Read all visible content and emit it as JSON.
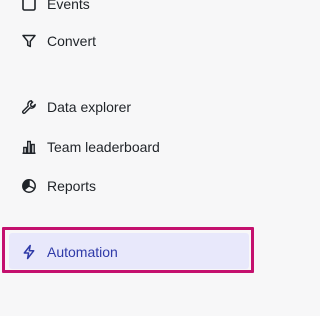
{
  "sidebar": {
    "items": [
      {
        "label": "Events",
        "icon": "square-icon"
      },
      {
        "label": "Convert",
        "icon": "filter-funnel-icon"
      },
      {
        "label": "Data explorer",
        "icon": "wrench-icon"
      },
      {
        "label": "Team leaderboard",
        "icon": "bar-chart-icon"
      },
      {
        "label": "Reports",
        "icon": "pie-chart-icon"
      },
      {
        "label": "Automation",
        "icon": "lightning-bolt-icon",
        "active": true
      }
    ]
  },
  "colors": {
    "active_outline": "#c4106e",
    "active_background": "#e8e8fb",
    "active_text": "#2f3aa8"
  }
}
